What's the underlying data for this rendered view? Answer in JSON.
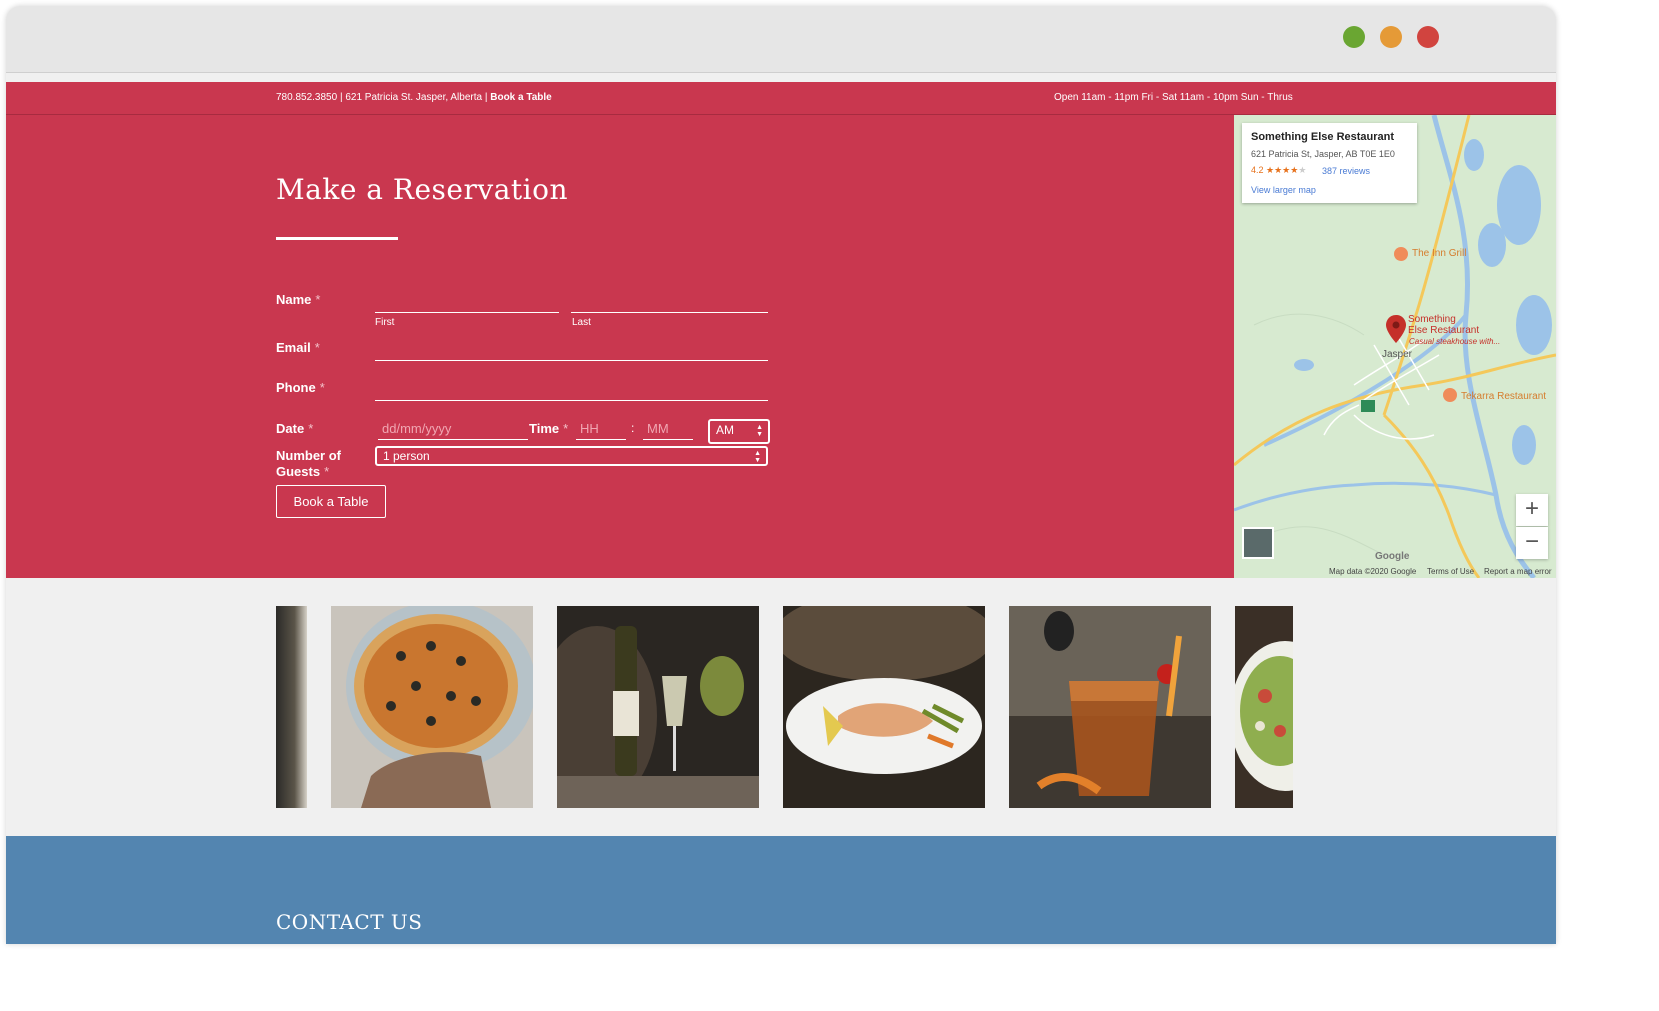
{
  "window": {
    "controls": [
      "green",
      "orange",
      "red"
    ]
  },
  "topbar": {
    "contact": "780.852.3850 | 621 Patricia St. Jasper, Alberta |",
    "book_link": "Book a Table",
    "hours": "Open 11am - 11pm Fri - Sat 11am - 10pm Sun - Thrus"
  },
  "form": {
    "title": "Make a Reservation",
    "name_label": "Name",
    "first_sub": "First",
    "last_sub": "Last",
    "email_label": "Email",
    "phone_label": "Phone",
    "date_label": "Date",
    "date_placeholder": "dd/mm/yyyy",
    "time_label": "Time",
    "hh_placeholder": "HH",
    "time_sep": ":",
    "mm_placeholder": "MM",
    "ampm_value": "AM",
    "guests_label_1": "Number of",
    "guests_label_2": "Guests",
    "guests_value": "1 person",
    "required_mark": "*",
    "submit_label": "Book a Table"
  },
  "map": {
    "place_name": "Something Else Restaurant",
    "address": "621 Patricia St, Jasper, AB T0E 1E0",
    "rating": "4.2",
    "stars": "★★★★",
    "stars_empty": "★",
    "reviews": "387 reviews",
    "view_larger": "View larger map",
    "labels": {
      "inn_grill": "The Inn Grill",
      "something_else_1": "Something",
      "something_else_2": "Else Restaurant",
      "something_else_3": "Casual steakhouse with...",
      "jasper": "Jasper",
      "tekarra": "Tekarra Restaurant"
    },
    "zoom_in": "+",
    "zoom_out": "−",
    "google": "Google",
    "map_data": "Map data ©2020 Google",
    "terms": "Terms of Use",
    "report": "Report a map error",
    "colors": {
      "land": "#d7ead0",
      "water": "#9cc3e8",
      "road": "#f4c85a"
    }
  },
  "gallery": {
    "photos": [
      "partial-left-photo",
      "pizza-photo",
      "wine-photo",
      "salmon-photo",
      "cocktail-photo",
      "partial-right-photo"
    ]
  },
  "footer": {
    "heading": "CONTACT US"
  },
  "colors": {
    "primary": "#c9374f",
    "footer": "#5385b0",
    "background": "#f0f0f0"
  }
}
